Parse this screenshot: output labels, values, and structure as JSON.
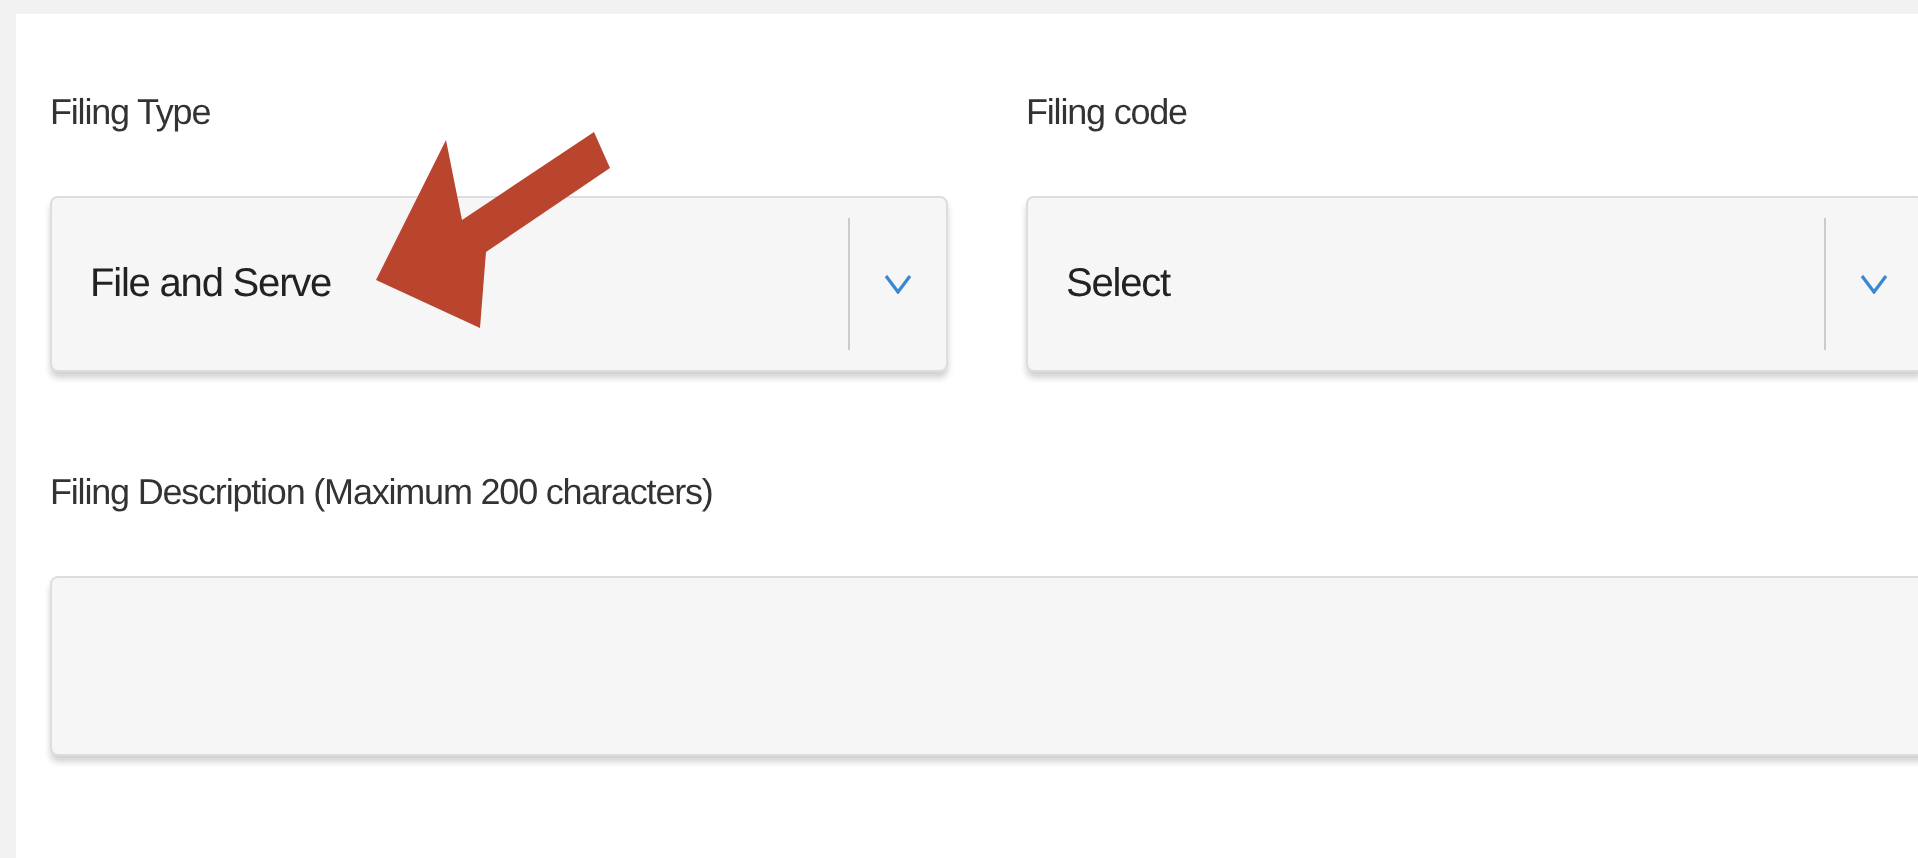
{
  "fields": [
    {
      "kind": "dropdown",
      "label": "Filing Type",
      "value": "File and Serve"
    },
    {
      "kind": "dropdown",
      "label": "Filing code",
      "value": "Select"
    },
    {
      "kind": "textarea",
      "label": "Filing Description (Maximum 200 characters)"
    }
  ],
  "annotations": [
    {
      "kind": "arrow"
    }
  ]
}
